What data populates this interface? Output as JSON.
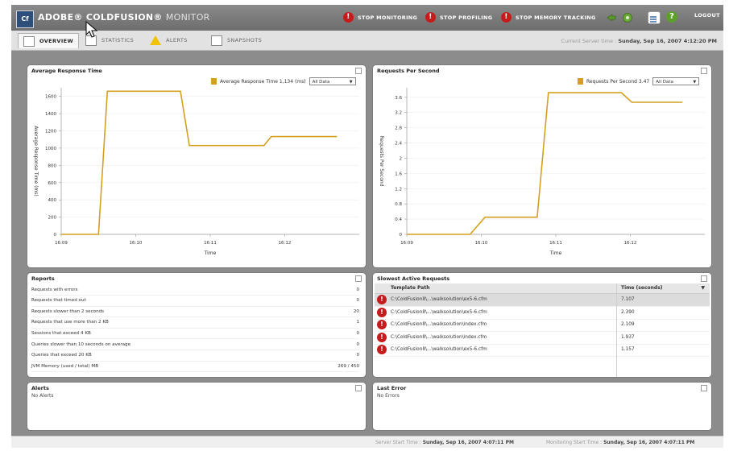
{
  "titlebar": {
    "brand_prefix": "ADOBE® COLDFUSION®",
    "brand_suffix": "MONITOR",
    "logo": "Cf",
    "actions": {
      "stop_monitoring": "STOP MONITORING",
      "stop_profiling": "STOP PROFILING",
      "stop_memory_tracking": "STOP MEMORY TRACKING"
    },
    "logout": "LOGOUT"
  },
  "tabs": {
    "overview": "OVERVIEW",
    "statistics": "STATISTICS",
    "alerts": "ALERTS",
    "snapshots": "SNAPSHOTS"
  },
  "server_time": {
    "label": "Current Server time :",
    "value": "Sunday, Sep 16, 2007 4:12:20 PM"
  },
  "avg_response": {
    "title": "Average Response Time",
    "legend": "Average Response Time 1,134 (ms)",
    "filter": "All Data"
  },
  "requests_per_second": {
    "title": "Requests Per Second",
    "legend": "Requests Per Second 3.47",
    "filter": "All Data"
  },
  "chart_data": [
    {
      "type": "line",
      "title": "Average Response Time",
      "xlabel": "Time",
      "ylabel": "Average Response Time (ms)",
      "x_ticks": [
        "16:09",
        "16:10",
        "16:11",
        "16:12"
      ],
      "y_ticks": [
        "0",
        "200",
        "400",
        "600",
        "800",
        "1000",
        "1200",
        "1400",
        "1600"
      ],
      "ylim": [
        0,
        1700
      ],
      "xlim": [
        0,
        4
      ],
      "series": [
        {
          "name": "Average Response Time 1,134 (ms)",
          "color": "#d4a020",
          "points": [
            [
              -0.35,
              0
            ],
            [
              0.5,
              0
            ],
            [
              0.62,
              1660
            ],
            [
              1.6,
              1660
            ],
            [
              1.72,
              1030
            ],
            [
              2.72,
              1030
            ],
            [
              2.82,
              1134
            ],
            [
              3.7,
              1134
            ]
          ]
        }
      ]
    },
    {
      "type": "line",
      "title": "Requests Per Second",
      "xlabel": "Time",
      "ylabel": "Requests Per Second",
      "x_ticks": [
        "16:09",
        "16:10",
        "16:11",
        "16:12"
      ],
      "y_ticks": [
        "0",
        "0.4",
        "0.8",
        "1.2",
        "1.6",
        "2",
        "2.4",
        "2.8",
        "3.2",
        "3.6"
      ],
      "ylim": [
        0,
        3.85
      ],
      "xlim": [
        0,
        4
      ],
      "series": [
        {
          "name": "Requests Per Second 3.47",
          "color": "#d4a020",
          "points": [
            [
              -0.2,
              0
            ],
            [
              0.85,
              0
            ],
            [
              1.05,
              0.45
            ],
            [
              1.75,
              0.45
            ],
            [
              1.9,
              3.72
            ],
            [
              2.88,
              3.72
            ],
            [
              3.02,
              3.47
            ],
            [
              3.7,
              3.47
            ]
          ]
        }
      ]
    }
  ],
  "reports": {
    "title": "Reports",
    "rows": [
      {
        "label": "Requests with errors",
        "value": "0"
      },
      {
        "label": "Requests that timed out",
        "value": "0"
      },
      {
        "label": "Requests slower than 2 seconds",
        "value": "20"
      },
      {
        "label": "Requests that use more than 2 KB",
        "value": "1"
      },
      {
        "label": "Sessions that exceed 4 KB",
        "value": "0"
      },
      {
        "label": "Queries slower than 10 seconds on average",
        "value": "0"
      },
      {
        "label": "Queries that exceed 20 KB",
        "value": "0"
      },
      {
        "label": "JVM Memory (used / total) MB",
        "value": "269 / 450"
      }
    ]
  },
  "slowest": {
    "title": "Slowest Active Requests",
    "col_path": "Template Path",
    "col_time": "Time (seconds)",
    "rows": [
      {
        "path": "C:\\ColdFusion8\\...\\walksolution\\ex5-6.cfm",
        "time": "7.107"
      },
      {
        "path": "C:\\ColdFusion8\\...\\walksolution\\ex5-6.cfm",
        "time": "2.390"
      },
      {
        "path": "C:\\ColdFusion8\\...\\walksolution\\index.cfm",
        "time": "2.109"
      },
      {
        "path": "C:\\ColdFusion8\\...\\walksolution\\index.cfm",
        "time": "1.937"
      },
      {
        "path": "C:\\ColdFusion8\\...\\walksolution\\ex5-6.cfm",
        "time": "1.157"
      }
    ]
  },
  "alerts": {
    "title": "Alerts",
    "text": "No Alerts"
  },
  "last_error": {
    "title": "Last Error",
    "text": "No Errors"
  },
  "statusbar": {
    "server_start_label": "Server Start Time :",
    "server_start_value": "Sunday, Sep 16, 2007 4:07:11 PM",
    "monitoring_start_label": "Monitoring Start Time :",
    "monitoring_start_value": "Sunday, Sep 16, 2007 4:07:11 PM"
  },
  "colors": {
    "series": "#d4a020",
    "alert_red": "#c71a1a",
    "chrome": "#8c8c8c"
  }
}
